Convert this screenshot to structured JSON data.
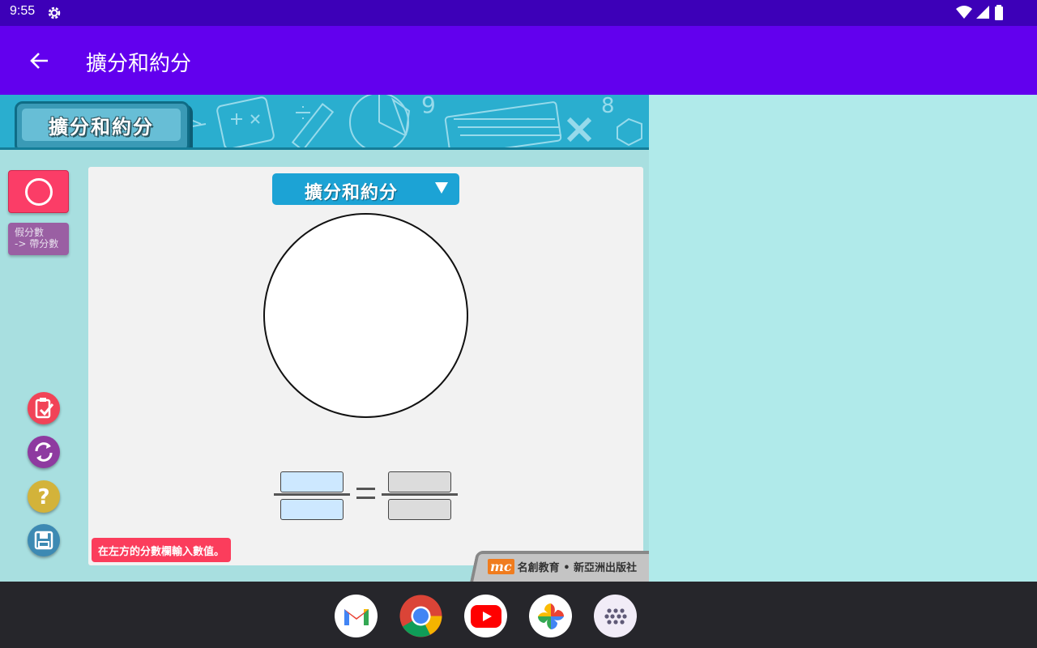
{
  "status_bar": {
    "time": "9:55"
  },
  "app_bar": {
    "title": "擴分和約分"
  },
  "banner": {
    "title": "擴分和約分"
  },
  "tools": {
    "improper_to_mixed": "假分數\n-> 帶分數"
  },
  "mode_select": {
    "selected": "擴分和約分"
  },
  "hint": "在左方的分數欄輸入數值。",
  "publisher": {
    "logo": "mc",
    "text": "名創教育 • 新亞洲出版社"
  },
  "colors": {
    "status_bar": "#3d00b8",
    "app_bar": "#6200ee",
    "accent_pink": "#fb3d67",
    "banner": "#2aaecf"
  },
  "icons": {
    "status": [
      "settings-gear-icon",
      "wifi-icon",
      "signal-icon",
      "battery-icon"
    ],
    "dock": [
      "gmail-icon",
      "chrome-icon",
      "youtube-icon",
      "photos-icon",
      "app-drawer-icon"
    ],
    "tools": [
      "circle-icon",
      "check-clipboard-icon",
      "refresh-icon",
      "help-icon",
      "save-disk-icon"
    ]
  }
}
